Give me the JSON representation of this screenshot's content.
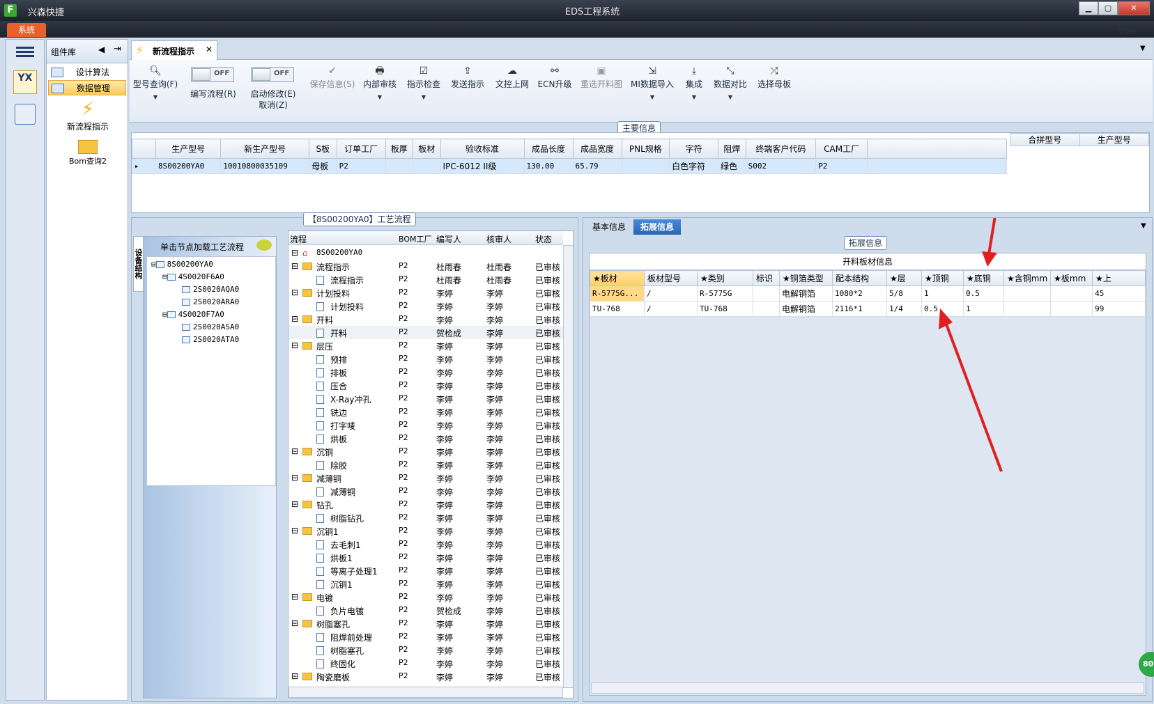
{
  "titlebar": {
    "app_name": "兴森快捷",
    "window_title": "EDS工程系统",
    "style_label": "Style",
    "system_menu": "系统"
  },
  "left_panel": {
    "header": "组件库",
    "items": [
      {
        "label": "设计算法"
      },
      {
        "label": "数据管理"
      }
    ],
    "big_items": [
      {
        "label": "新流程指示"
      },
      {
        "label": "Bom查询2"
      }
    ],
    "rail_badge": "YX"
  },
  "tab": {
    "label": "新流程指示"
  },
  "toolbar": {
    "model_query": "型号查询(F)",
    "edit_flow": "编写流程(R)",
    "edit_toggle": "OFF",
    "start_modify": "启动修改(E)",
    "start_toggle": "OFF",
    "cancel": "取消(Z)",
    "save_info": "保存信息(S)",
    "internal_review": "内部审核",
    "indication_check": "指示检查",
    "send_indication": "发送指示",
    "upload_web": "文控上网",
    "ecn_upgrade": "ECN升级",
    "reselect_chart": "重选开料图",
    "mi_import": "MI数据导入",
    "integrate": "集成",
    "data_compare": "数据对比",
    "select_master": "选择母板"
  },
  "main_info": {
    "title": "主要信息",
    "columns": [
      "生产型号",
      "新生产型号",
      "S板",
      "订单工厂",
      "板厚",
      "板材",
      "验收标准",
      "成品长度",
      "成品宽度",
      "PNL规格",
      "字符",
      "阻焊",
      "终端客户代码",
      "CAM工厂"
    ],
    "row": [
      "8S00200YA0",
      "10010800035109",
      "母板",
      "P2",
      "",
      "",
      "IPC-6012 II级",
      "130.00",
      "65.79",
      "",
      "白色字符",
      "绿色",
      "S002",
      "P2"
    ],
    "side_columns": [
      "合拼型号",
      "生产型号"
    ]
  },
  "process": {
    "title": "【8S00200YA0】工艺流程",
    "side_tab": "设备结构",
    "tree_hint": "单击节点加载工艺流程",
    "tree": [
      {
        "label": "8S00200YA0",
        "level": 0
      },
      {
        "label": "4S0020F6A0",
        "level": 1
      },
      {
        "label": "2S0020AQA0",
        "level": 2
      },
      {
        "label": "2S0020ARA0",
        "level": 2
      },
      {
        "label": "4S0020F7A0",
        "level": 1
      },
      {
        "label": "2S0020ASA0",
        "level": 2
      },
      {
        "label": "2S0020ATA0",
        "level": 2
      }
    ],
    "columns": [
      "流程",
      "BOM工厂",
      "编写人",
      "核审人",
      "状态"
    ],
    "root": "8S00200YA0",
    "rows": [
      {
        "name": "流程指示",
        "folder": true,
        "bom": "P2",
        "writer": "杜雨春",
        "reviewer": "杜雨春",
        "status": "已审核"
      },
      {
        "name": "流程指示",
        "folder": false,
        "bom": "P2",
        "writer": "杜雨春",
        "reviewer": "杜雨春",
        "status": "已审核"
      },
      {
        "name": "计划投料",
        "folder": true,
        "bom": "P2",
        "writer": "李婷",
        "reviewer": "李婷",
        "status": "已审核"
      },
      {
        "name": "计划投料",
        "folder": false,
        "bom": "P2",
        "writer": "李婷",
        "reviewer": "李婷",
        "status": "已审核"
      },
      {
        "name": "开料",
        "folder": true,
        "bom": "P2",
        "writer": "李婷",
        "reviewer": "李婷",
        "status": "已审核"
      },
      {
        "name": "开料",
        "folder": false,
        "bom": "P2",
        "writer": "贺检成",
        "reviewer": "李婷",
        "status": "已审核"
      },
      {
        "name": "层压",
        "folder": true,
        "bom": "P2",
        "writer": "李婷",
        "reviewer": "李婷",
        "status": "已审核"
      },
      {
        "name": "预排",
        "folder": false,
        "bom": "P2",
        "writer": "李婷",
        "reviewer": "李婷",
        "status": "已审核"
      },
      {
        "name": "排板",
        "folder": false,
        "bom": "P2",
        "writer": "李婷",
        "reviewer": "李婷",
        "status": "已审核"
      },
      {
        "name": "压合",
        "folder": false,
        "bom": "P2",
        "writer": "李婷",
        "reviewer": "李婷",
        "status": "已审核"
      },
      {
        "name": "X-Ray冲孔",
        "folder": false,
        "bom": "P2",
        "writer": "李婷",
        "reviewer": "李婷",
        "status": "已审核"
      },
      {
        "name": "铣边",
        "folder": false,
        "bom": "P2",
        "writer": "李婷",
        "reviewer": "李婷",
        "status": "已审核"
      },
      {
        "name": "打字唛",
        "folder": false,
        "bom": "P2",
        "writer": "李婷",
        "reviewer": "李婷",
        "status": "已审核"
      },
      {
        "name": "烘板",
        "folder": false,
        "bom": "P2",
        "writer": "李婷",
        "reviewer": "李婷",
        "status": "已审核"
      },
      {
        "name": "沉铜",
        "folder": true,
        "bom": "P2",
        "writer": "李婷",
        "reviewer": "李婷",
        "status": "已审核"
      },
      {
        "name": "除胶",
        "folder": false,
        "bom": "P2",
        "writer": "李婷",
        "reviewer": "李婷",
        "status": "已审核"
      },
      {
        "name": "减薄铜",
        "folder": true,
        "bom": "P2",
        "writer": "李婷",
        "reviewer": "李婷",
        "status": "已审核"
      },
      {
        "name": "减薄铜",
        "folder": false,
        "bom": "P2",
        "writer": "李婷",
        "reviewer": "李婷",
        "status": "已审核"
      },
      {
        "name": "钻孔",
        "folder": true,
        "bom": "P2",
        "writer": "李婷",
        "reviewer": "李婷",
        "status": "已审核"
      },
      {
        "name": "树脂钻孔",
        "folder": false,
        "bom": "P2",
        "writer": "李婷",
        "reviewer": "李婷",
        "status": "已审核"
      },
      {
        "name": "沉铜1",
        "folder": true,
        "bom": "P2",
        "writer": "李婷",
        "reviewer": "李婷",
        "status": "已审核"
      },
      {
        "name": "去毛刺1",
        "folder": false,
        "bom": "P2",
        "writer": "李婷",
        "reviewer": "李婷",
        "status": "已审核"
      },
      {
        "name": "烘板1",
        "folder": false,
        "bom": "P2",
        "writer": "李婷",
        "reviewer": "李婷",
        "status": "已审核"
      },
      {
        "name": "等离子处理1",
        "folder": false,
        "bom": "P2",
        "writer": "李婷",
        "reviewer": "李婷",
        "status": "已审核"
      },
      {
        "name": "沉铜1",
        "folder": false,
        "bom": "P2",
        "writer": "李婷",
        "reviewer": "李婷",
        "status": "已审核"
      },
      {
        "name": "电镀",
        "folder": true,
        "bom": "P2",
        "writer": "李婷",
        "reviewer": "李婷",
        "status": "已审核"
      },
      {
        "name": "负片电镀",
        "folder": false,
        "bom": "P2",
        "writer": "贺检成",
        "reviewer": "李婷",
        "status": "已审核"
      },
      {
        "name": "树脂塞孔",
        "folder": true,
        "bom": "P2",
        "writer": "李婷",
        "reviewer": "李婷",
        "status": "已审核"
      },
      {
        "name": "阻焊前处理",
        "folder": false,
        "bom": "P2",
        "writer": "李婷",
        "reviewer": "李婷",
        "status": "已审核"
      },
      {
        "name": "树脂塞孔",
        "folder": false,
        "bom": "P2",
        "writer": "李婷",
        "reviewer": "李婷",
        "status": "已审核"
      },
      {
        "name": "终固化",
        "folder": false,
        "bom": "P2",
        "writer": "李婷",
        "reviewer": "李婷",
        "status": "已审核"
      },
      {
        "name": "陶瓷磨板",
        "folder": true,
        "bom": "P2",
        "writer": "李婷",
        "reviewer": "李婷",
        "status": "已审核"
      }
    ]
  },
  "right": {
    "tabs": [
      "基本信息",
      "拓展信息"
    ],
    "section_title": "拓展信息",
    "grid_title": "开料板材信息",
    "columns": [
      "★板材",
      "板材型号",
      "★类别",
      "标识",
      "★铜箔类型",
      "配本结构",
      "★层",
      "★顶铜",
      "★底铜",
      "★含铜mm",
      "★板mm",
      "★上"
    ],
    "rows": [
      [
        "R-5775G...",
        "/",
        "R-5775G",
        "",
        "电解铜箔",
        "1080*2",
        "5/8",
        "1",
        "0.5",
        "",
        "",
        "45"
      ],
      [
        "TU-768",
        "/",
        "TU-768",
        "",
        "电解铜箔",
        "2116*1",
        "1/4",
        "0.5",
        "1",
        "",
        "",
        "99"
      ]
    ],
    "badge": "80"
  },
  "colors": {
    "accent_orange": "#e8602a",
    "selection": "#ffc95c",
    "annotation_arrow": "#e02020"
  }
}
